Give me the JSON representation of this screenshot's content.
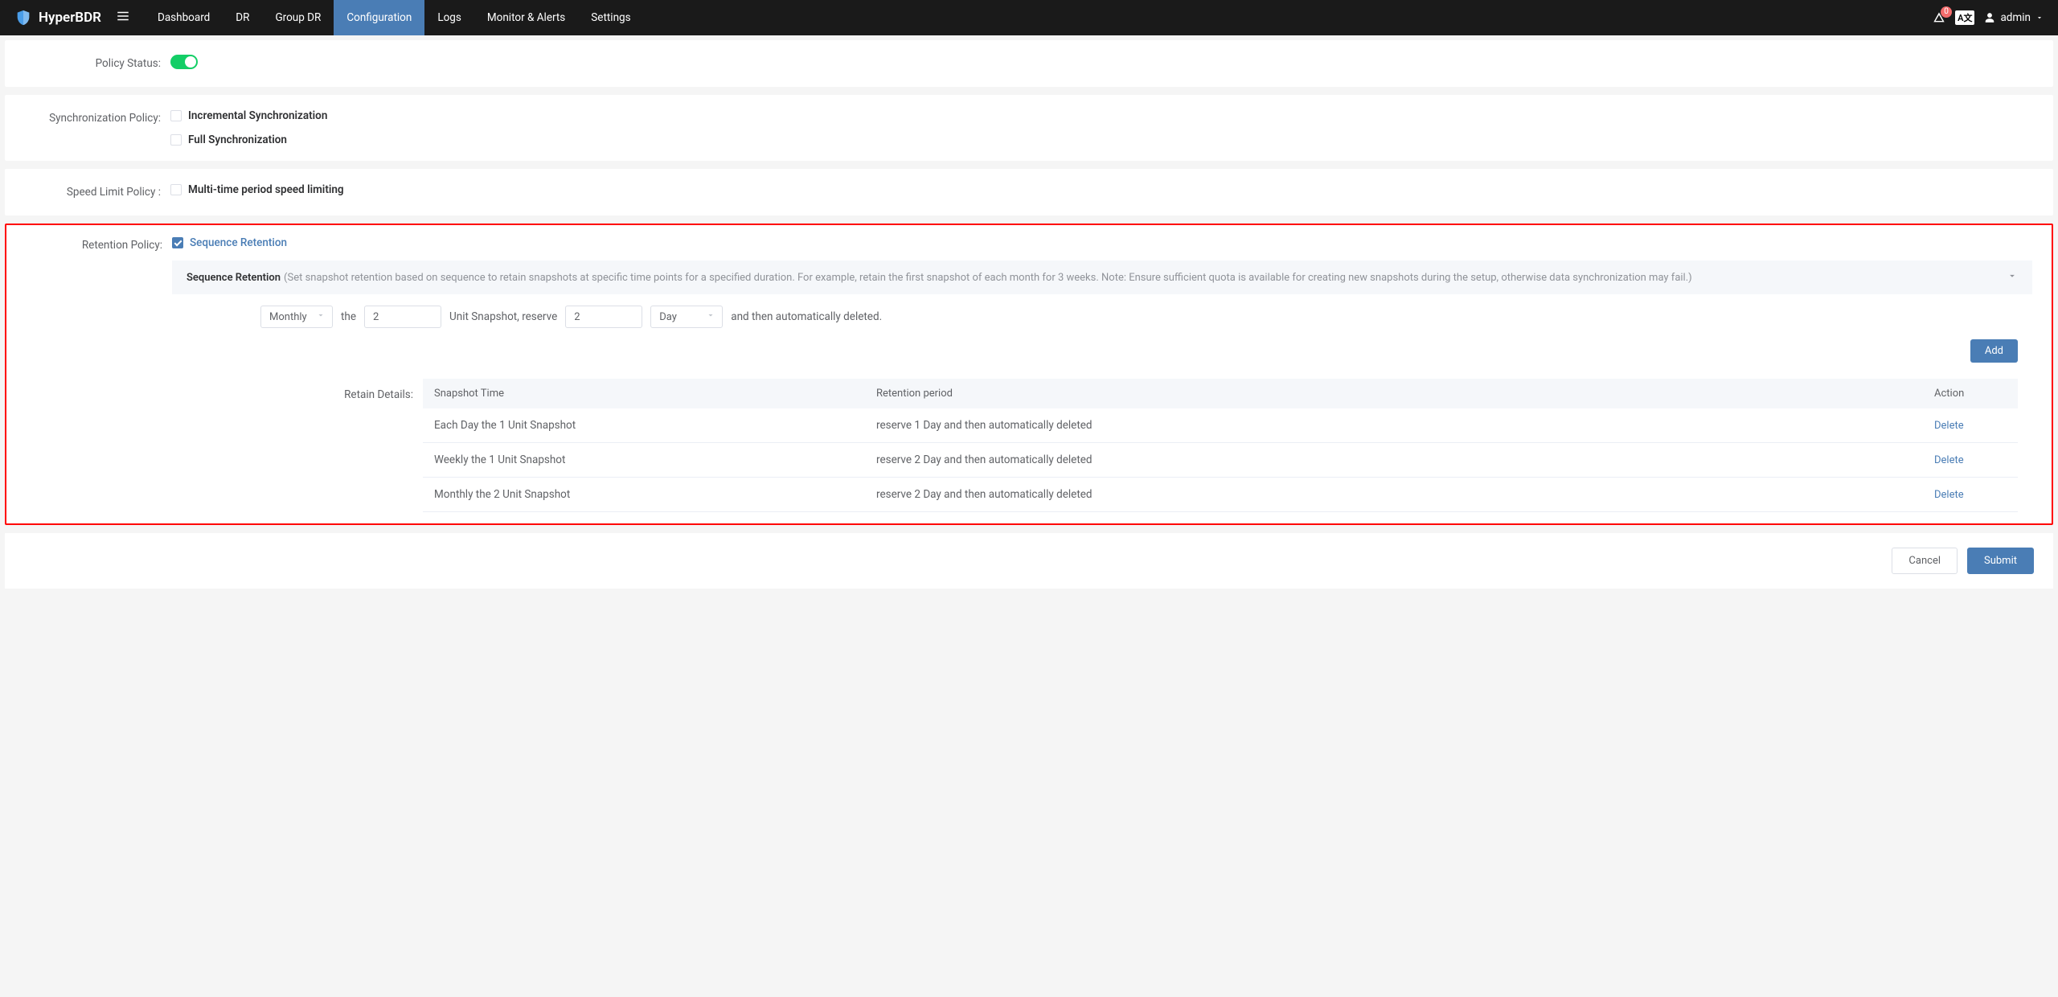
{
  "app": {
    "name": "HyperBDR"
  },
  "nav": {
    "items": [
      "Dashboard",
      "DR",
      "Group DR",
      "Configuration",
      "Logs",
      "Monitor & Alerts",
      "Settings"
    ],
    "active_index": 3
  },
  "topbar": {
    "alert_count": "0",
    "lang": "A文",
    "user": "admin"
  },
  "sections": {
    "policy_status": {
      "label": "Policy Status:"
    },
    "sync": {
      "label": "Synchronization Policy:",
      "options": [
        {
          "label": "Incremental Synchronization",
          "checked": false
        },
        {
          "label": "Full Synchronization",
          "checked": false
        }
      ]
    },
    "speed": {
      "label": "Speed Limit Policy :",
      "option": {
        "label": "Multi-time period speed limiting",
        "checked": false
      }
    },
    "retention": {
      "label": "Retention Policy:",
      "option": {
        "label": "Sequence Retention",
        "checked": true
      },
      "desc_title": "Sequence Retention",
      "desc_text": "(Set snapshot retention based on sequence to retain snapshots at specific time points for a specified duration. For example, retain the first snapshot of each month for 3 weeks. Note: Ensure sufficient quota is available for creating new snapshots during the setup, otherwise data synchronization may fail.)",
      "builder": {
        "freq": "Monthly",
        "the": "the",
        "unit_value": "2",
        "unit_text": "Unit Snapshot, reserve",
        "reserve_value": "2",
        "period": "Day",
        "tail": "and then automatically deleted."
      },
      "add_label": "Add",
      "details_label": "Retain Details:",
      "table": {
        "headers": {
          "time": "Snapshot Time",
          "period": "Retention period",
          "action": "Action"
        },
        "rows": [
          {
            "time": "Each Day the 1 Unit Snapshot",
            "period": "reserve 1 Day and then automatically deleted",
            "action": "Delete"
          },
          {
            "time": "Weekly the 1 Unit Snapshot",
            "period": "reserve 2 Day and then automatically deleted",
            "action": "Delete"
          },
          {
            "time": "Monthly the 2 Unit Snapshot",
            "period": "reserve 2 Day and then automatically deleted",
            "action": "Delete"
          }
        ]
      }
    }
  },
  "footer": {
    "cancel": "Cancel",
    "submit": "Submit"
  }
}
